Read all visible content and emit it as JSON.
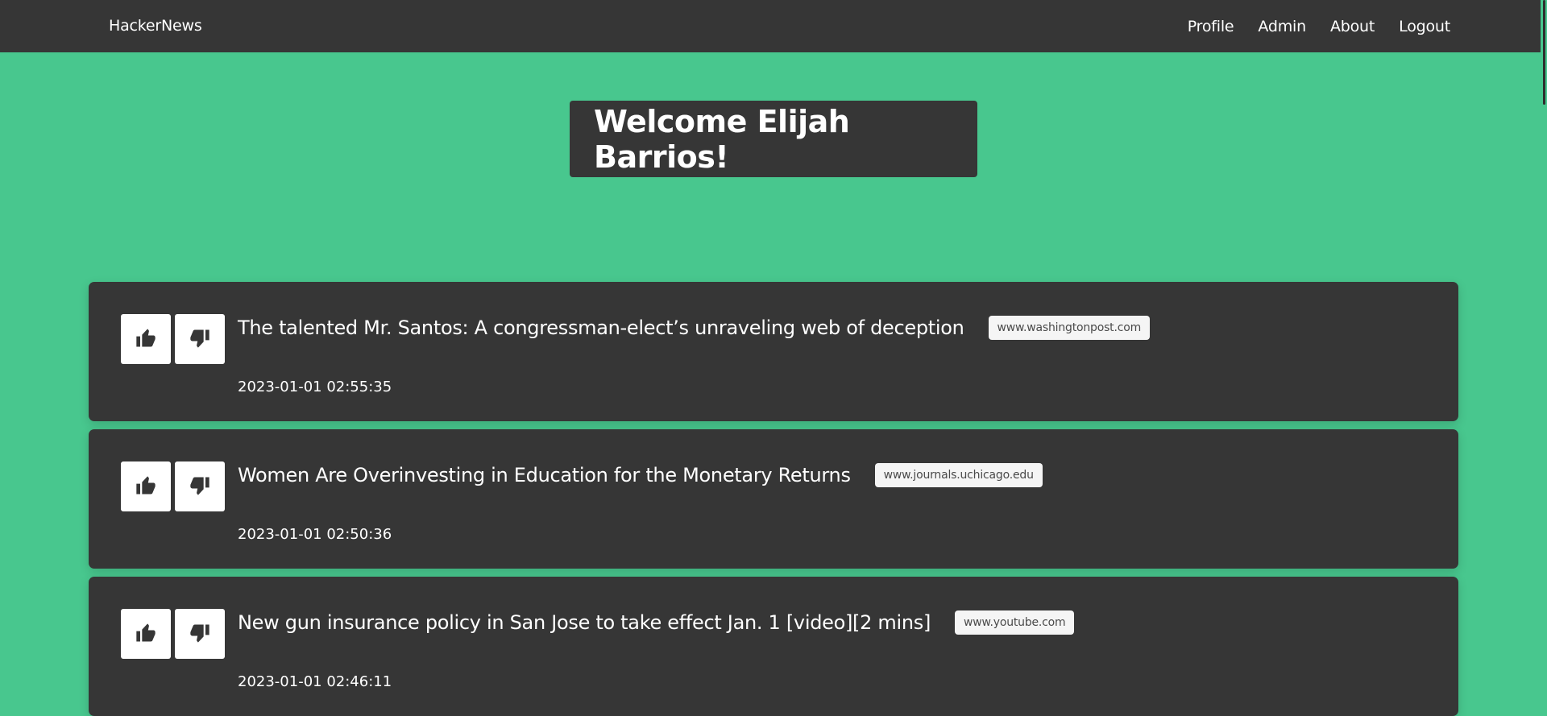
{
  "navbar": {
    "brand": "HackerNews",
    "links": [
      "Profile",
      "Admin",
      "About",
      "Logout"
    ]
  },
  "hero": {
    "title": "Welcome Elijah Barrios!"
  },
  "posts": [
    {
      "title": "The talented Mr. Santos: A congressman-elect’s unraveling web of deception",
      "domain": "www.washingtonpost.com",
      "timestamp": "2023-01-01 02:55:35"
    },
    {
      "title": "Women Are Overinvesting in Education for the Monetary Returns",
      "domain": "www.journals.uchicago.edu",
      "timestamp": "2023-01-01 02:50:36"
    },
    {
      "title": "New gun insurance policy in San Jose to take effect Jan. 1 [video][2 mins]",
      "domain": "www.youtube.com",
      "timestamp": "2023-01-01 02:46:11"
    }
  ],
  "icons": {
    "upvote": "thumbs-up-icon",
    "downvote": "thumbs-down-icon"
  },
  "colors": {
    "background": "#48c78e",
    "dark": "#363636",
    "tag": "#f5f5f5"
  }
}
